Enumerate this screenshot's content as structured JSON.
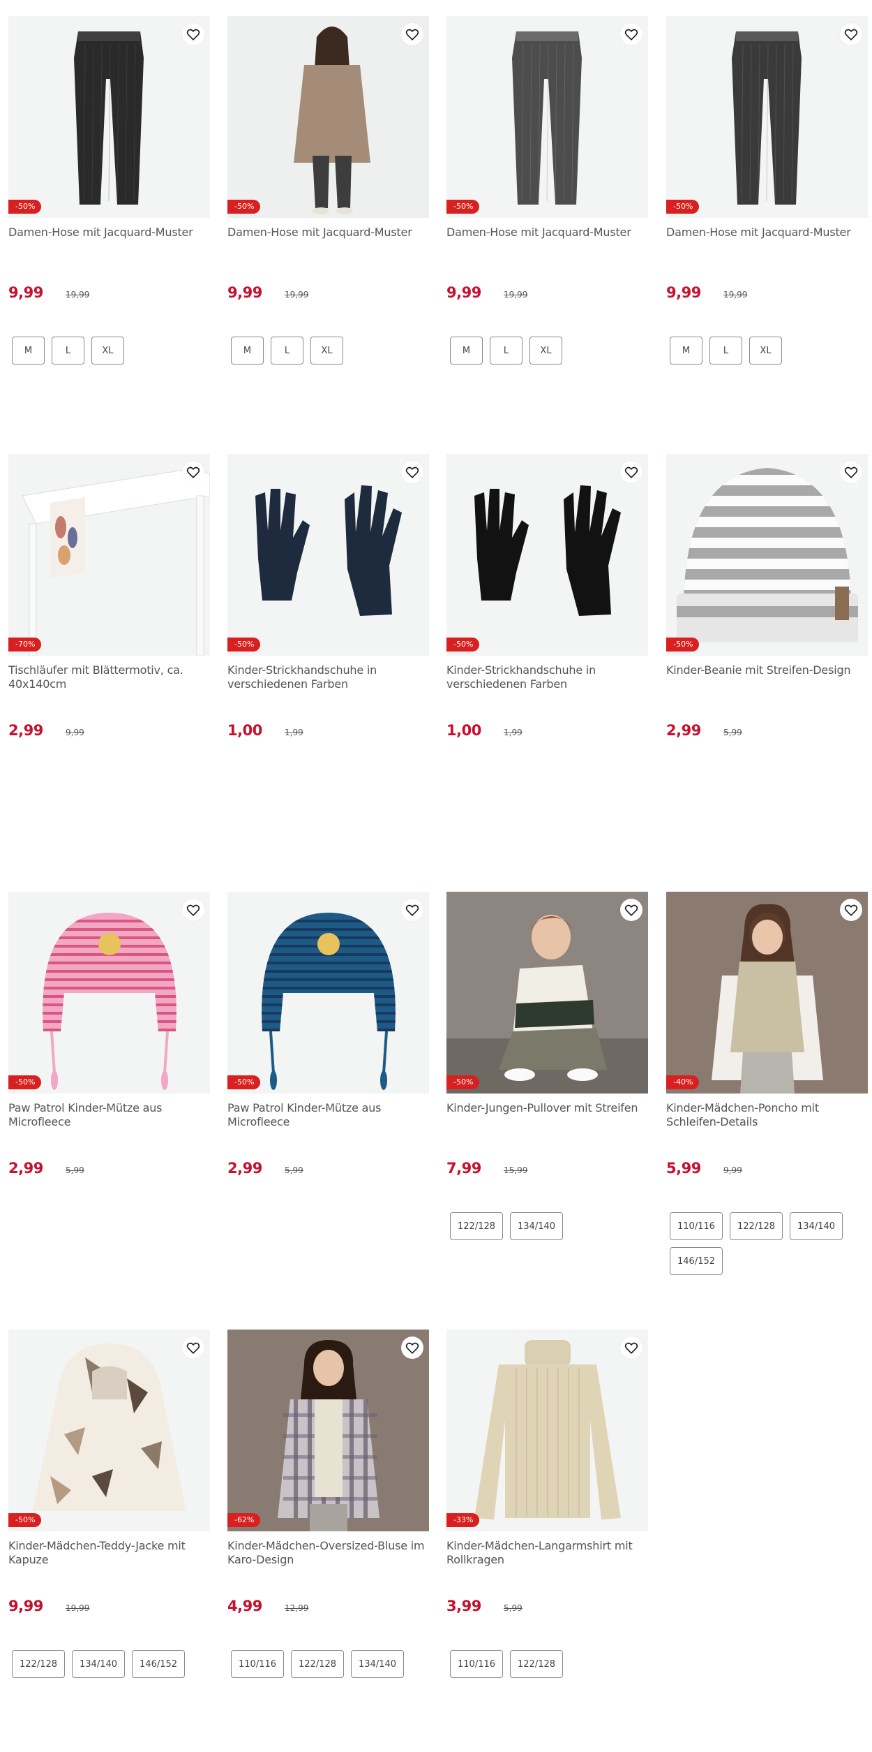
{
  "products": [
    {
      "title": "Damen-Hose mit Jacquard-Muster",
      "price": "9,99",
      "old_price": "19,99",
      "discount": "-50%",
      "sizes": [
        "M",
        "L",
        "XL"
      ],
      "image": "pants-black"
    },
    {
      "title": "Damen-Hose mit Jacquard-Muster",
      "price": "9,99",
      "old_price": "19,99",
      "discount": "-50%",
      "sizes": [
        "M",
        "L",
        "XL"
      ],
      "image": "model-fur-coat"
    },
    {
      "title": "Damen-Hose mit Jacquard-Muster",
      "price": "9,99",
      "old_price": "19,99",
      "discount": "-50%",
      "sizes": [
        "M",
        "L",
        "XL"
      ],
      "image": "pants-grey"
    },
    {
      "title": "Damen-Hose mit Jacquard-Muster",
      "price": "9,99",
      "old_price": "19,99",
      "discount": "-50%",
      "sizes": [
        "M",
        "L",
        "XL"
      ],
      "image": "pants-darkgrey"
    },
    {
      "title": "Tischläufer mit Blättermotiv, ca. 40x140cm",
      "price": "2,99",
      "old_price": "9,99",
      "discount": "-70%",
      "sizes": [],
      "image": "table-runner"
    },
    {
      "title": "Kinder-Strickhandschuhe in verschiedenen Farben",
      "price": "1,00",
      "old_price": "1,99",
      "discount": "-50%",
      "sizes": [],
      "image": "gloves-navy"
    },
    {
      "title": "Kinder-Strickhandschuhe in verschiedenen Farben",
      "price": "1,00",
      "old_price": "1,99",
      "discount": "-50%",
      "sizes": [],
      "image": "gloves-black"
    },
    {
      "title": "Kinder-Beanie mit Streifen-Design",
      "price": "2,99",
      "old_price": "5,99",
      "discount": "-50%",
      "sizes": [],
      "image": "beanie-striped"
    },
    {
      "title": "Paw Patrol Kinder-Mütze aus Microfleece",
      "price": "2,99",
      "old_price": "5,99",
      "discount": "-50%",
      "sizes": [],
      "image": "hat-pink"
    },
    {
      "title": "Paw Patrol Kinder-Mütze aus Microfleece",
      "price": "2,99",
      "old_price": "5,99",
      "discount": "-50%",
      "sizes": [],
      "image": "hat-blue"
    },
    {
      "title": "Kinder-Jungen-Pullover mit Streifen",
      "price": "7,99",
      "old_price": "15,99",
      "discount": "-50%",
      "sizes": [
        "122/128",
        "134/140"
      ],
      "image": "boy-pullover"
    },
    {
      "title": "Kinder-Mädchen-Poncho mit Schleifen-Details",
      "price": "5,99",
      "old_price": "9,99",
      "discount": "-40%",
      "sizes": [
        "110/116",
        "122/128",
        "134/140",
        "146/152"
      ],
      "image": "girl-poncho"
    },
    {
      "title": "Kinder-Mädchen-Teddy-Jacke mit Kapuze",
      "price": "9,99",
      "old_price": "19,99",
      "discount": "-50%",
      "sizes": [
        "122/128",
        "134/140",
        "146/152"
      ],
      "image": "teddy-jacket"
    },
    {
      "title": "Kinder-Mädchen-Oversized-Bluse im Karo-Design",
      "price": "4,99",
      "old_price": "12,99",
      "discount": "-62%",
      "sizes": [
        "110/116",
        "122/128",
        "134/140"
      ],
      "image": "girl-plaid"
    },
    {
      "title": "Kinder-Mädchen-Langarmshirt mit Rollkragen",
      "price": "3,99",
      "old_price": "5,99",
      "discount": "-33%",
      "sizes": [
        "110/116",
        "122/128"
      ],
      "image": "turtleneck"
    }
  ],
  "wishlist_icon": "heart-icon",
  "colors": {
    "price": "#c8102e",
    "badge": "#d7201f",
    "image_bg": "#f3f4f4"
  }
}
